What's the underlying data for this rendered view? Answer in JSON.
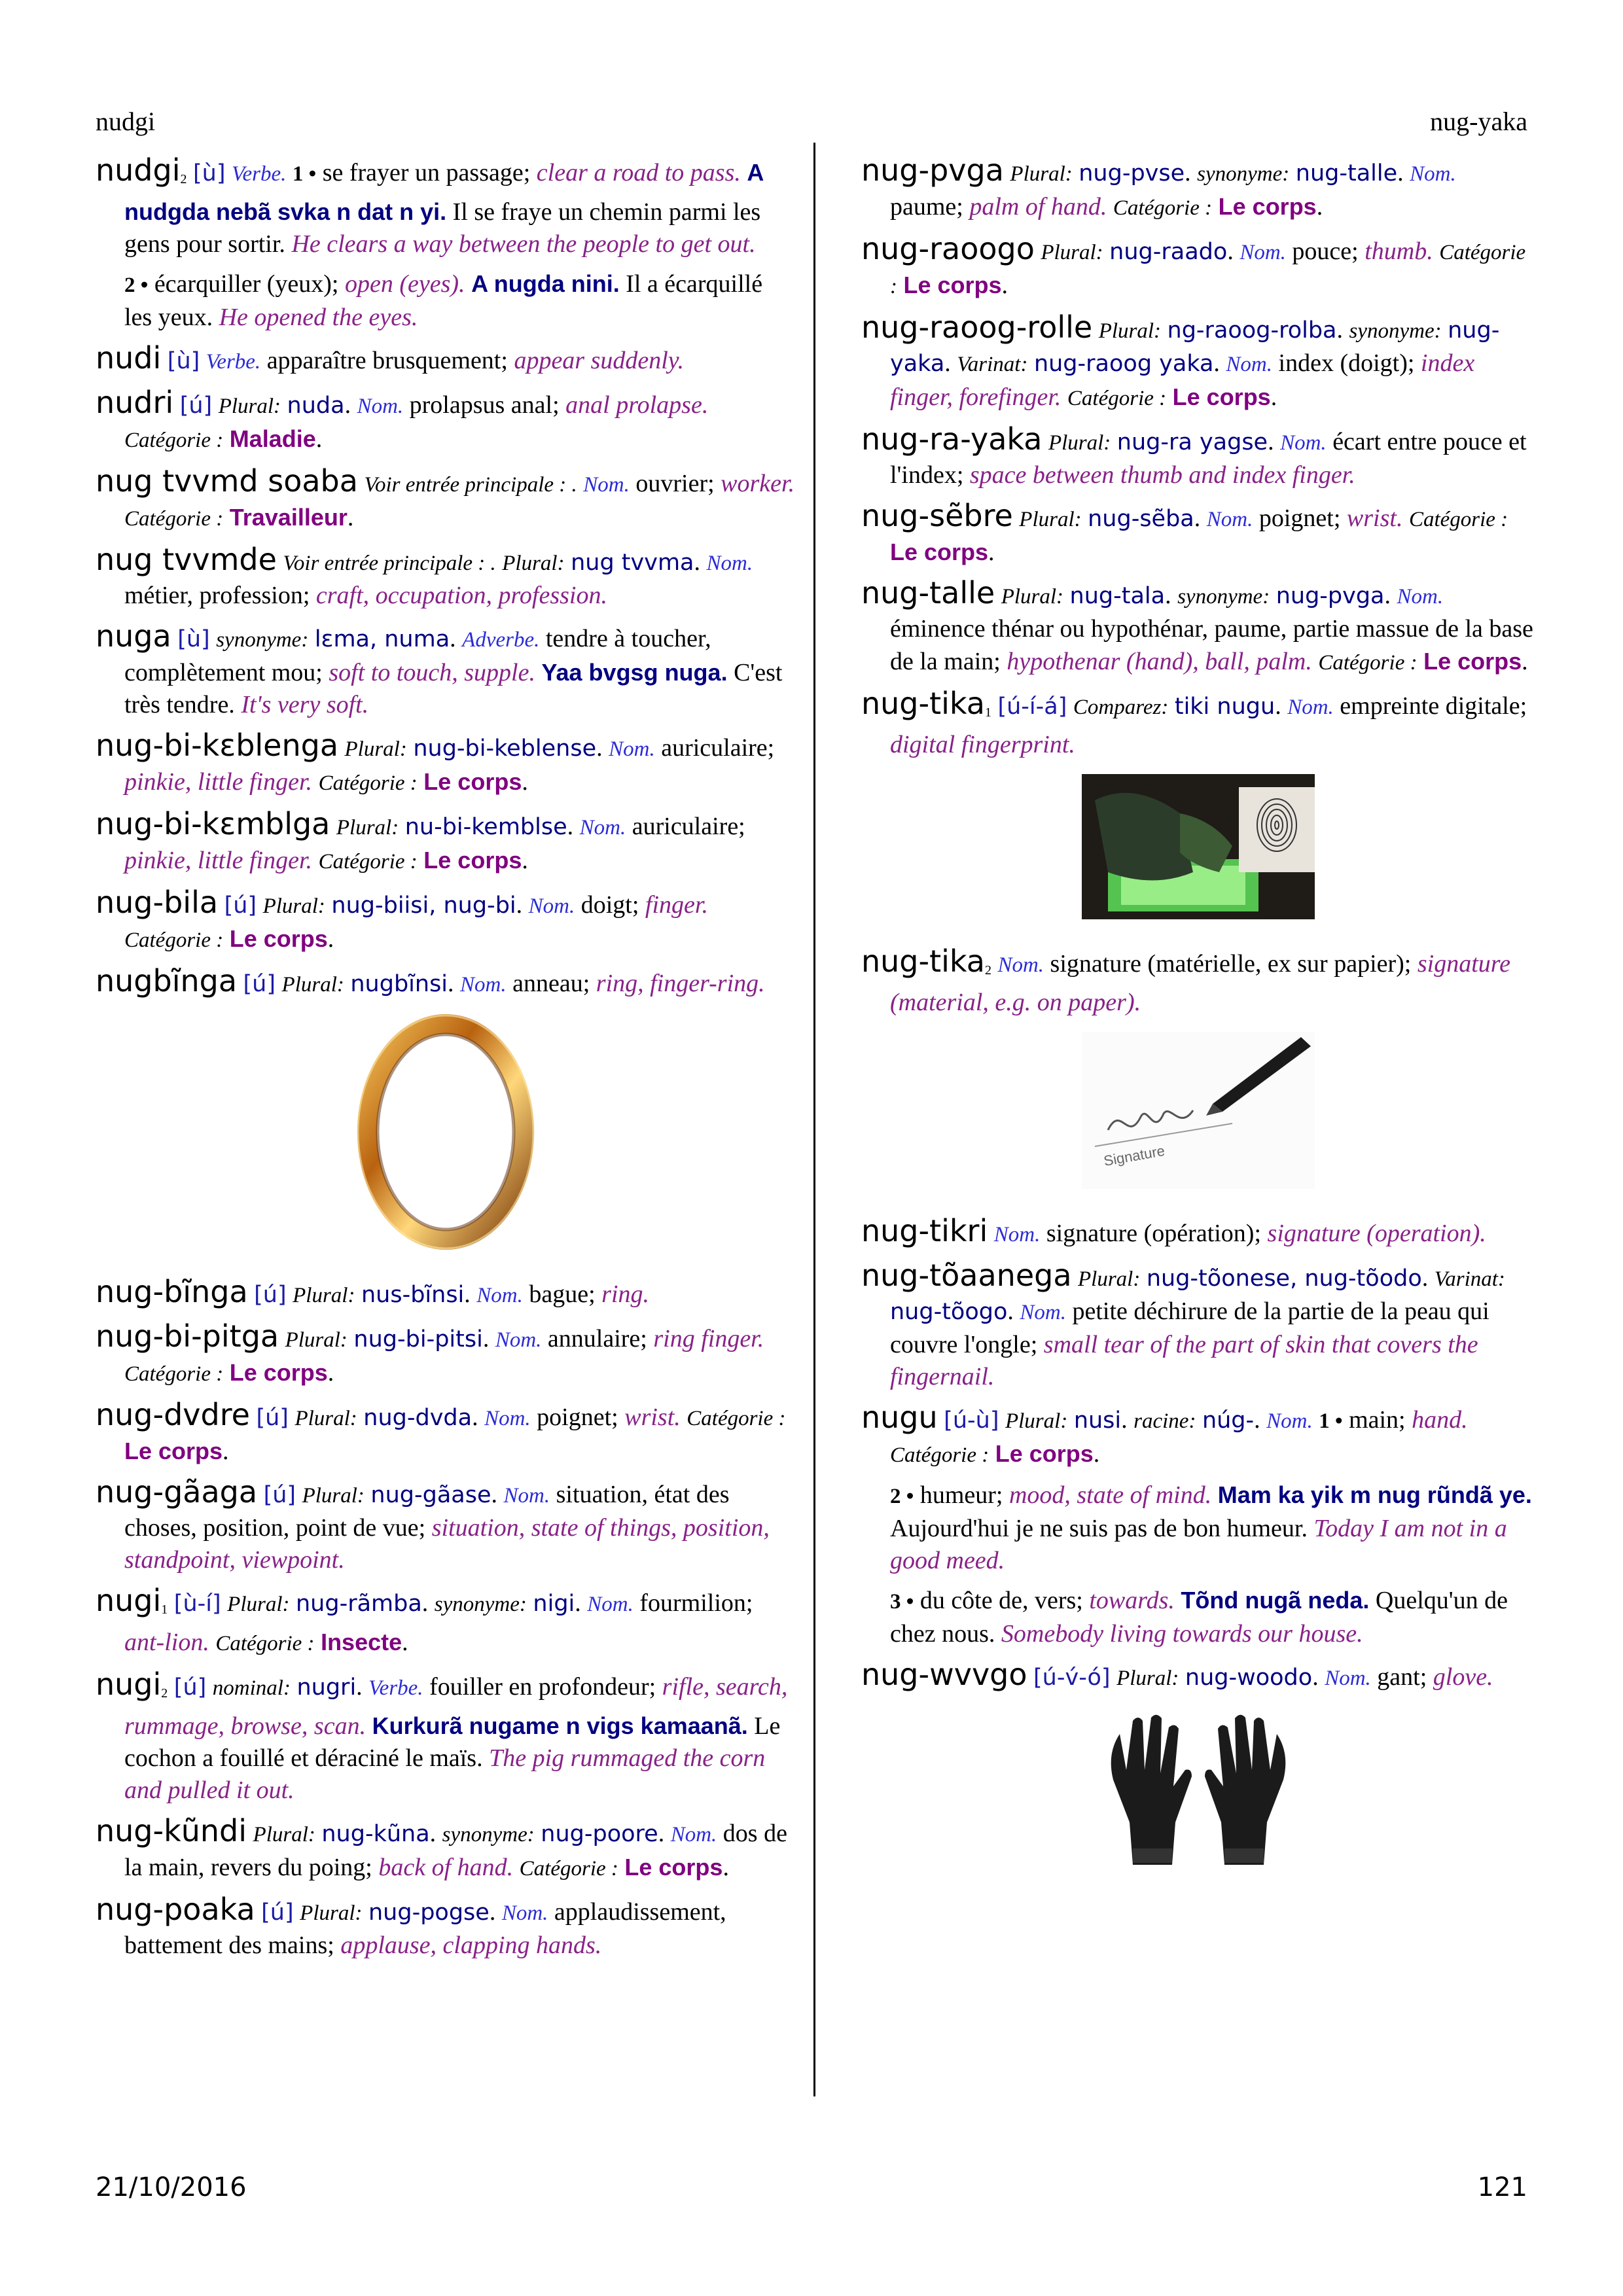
{
  "header": {
    "left": "nudgi",
    "right": "nug-yaka"
  },
  "footer": {
    "date": "21/10/2016",
    "page": "121"
  },
  "labels": {
    "plural": "Plural:",
    "synonyme": "synonyme:",
    "varinat": "Varinat:",
    "comparez": "Comparez:",
    "nominal": "nominal:",
    "racine": "racine:",
    "voir": "Voir entrée principale : .",
    "categorie": "Catégorie :",
    "nom": "Nom.",
    "verbe": "Verbe.",
    "adverbe": "Adverbe.",
    "le_corps": "Le corps",
    "maladie": "Maladie",
    "travailleur": "Travailleur",
    "insecte": "Insecte"
  },
  "entries": {
    "nudgi2": {
      "hw": "nudgi",
      "hom": "2",
      "ph": "[ù]",
      "s1_num": "1 •",
      "s1_fr": "se frayer un passage;",
      "s1_en": "clear a road to pass.",
      "s1_ex": "A nudgda nebã sᴠka n dat n yi.",
      "s1_ex_fr": "Il se fraye un chemin parmi les gens pour sortir.",
      "s1_ex_en": "He clears a way between the people to get out.",
      "s2_num": "2 •",
      "s2_fr": "écarquiller (yeux);",
      "s2_en": "open (eyes).",
      "s2_ex": "A nugda nini.",
      "s2_ex_fr": "Il a écarquillé les yeux.",
      "s2_ex_en": "He opened the eyes."
    },
    "nudi": {
      "hw": "nudi",
      "ph": "[ù]",
      "fr": "apparaître brusquement;",
      "en": "appear suddenly."
    },
    "nudri": {
      "hw": "nudri",
      "ph": "[ú]",
      "pl": "nuda",
      "fr": "prolapsus anal;",
      "en": "anal prolapse."
    },
    "soaba": {
      "hw": "nug tᴠᴠmd soaba",
      "fr": "ouvrier;",
      "en": "worker."
    },
    "tvvmde": {
      "hw": "nug tᴠᴠmde",
      "pl": "nug tᴠᴠma",
      "fr": "métier, profession;",
      "en": "craft, occupation, profession."
    },
    "nuga": {
      "hw": "nuga",
      "ph": "[ù]",
      "syn": "lɛma, numa",
      "fr": "tendre à toucher, complètement mou;",
      "en": "soft to touch, supple.",
      "ex": "Yaa bᴠgsg nuga.",
      "ex_fr": "C'est très tendre.",
      "ex_en": "It's very soft."
    },
    "kebl": {
      "hw": "nug-bi-kɛblenga",
      "pl": "nug-bi-keblense",
      "fr": "auriculaire;",
      "en": "pinkie, little finger."
    },
    "kembl": {
      "hw": "nug-bi-kɛmblga",
      "pl": "nu-bi-kemblse",
      "fr": "auriculaire;",
      "en": "pinkie, little finger."
    },
    "bila": {
      "hw": "nug-bila",
      "ph": "[ú]",
      "pl": "nug-biisi, nug-bi",
      "fr": "doigt;",
      "en": "finger."
    },
    "nugbinga": {
      "hw": "nugbĩnga",
      "ph": "[ú]",
      "pl": "nugbĩnsi",
      "fr": "anneau;",
      "en": "ring, finger-ring."
    },
    "binga": {
      "hw": "nug-bĩnga",
      "ph": "[ú]",
      "pl": "nus-bĩnsi",
      "fr": "bague;",
      "en": "ring."
    },
    "pitga": {
      "hw": "nug-bi-pitga",
      "pl": "nug-bi-pitsi",
      "fr": "annulaire;",
      "en": "ring finger."
    },
    "dvdre": {
      "hw": "nug-dᴠdre",
      "ph": "[ú]",
      "pl": "nug-dᴠda",
      "fr": "poignet;",
      "en": "wrist."
    },
    "gaaga": {
      "hw": "nug-gãaga",
      "ph": "[ú]",
      "pl": "nug-gãase",
      "fr": "situation, état des choses, position, point de vue;",
      "en": "situation, state of things, position, standpoint, viewpoint."
    },
    "nugi1": {
      "hw": "nugi",
      "hom": "1",
      "ph": "[ù-í]",
      "pl": "nug-rãmba",
      "syn": "nigi",
      "fr": "fourmilion;",
      "en": "ant-lion."
    },
    "nugi2": {
      "hw": "nugi",
      "hom": "2",
      "ph": "[ú]",
      "nominal": "nugri",
      "fr": "fouiller en profondeur;",
      "en": "rifle, search, rummage, browse, scan.",
      "ex": "Kurkurã nugame n vigs kamaanã.",
      "ex_fr": "Le cochon a fouillé et déraciné le maïs.",
      "ex_en": "The pig rummaged the corn and pulled it out."
    },
    "kundi": {
      "hw": "nug-kũndi",
      "pl": "nug-kũna",
      "syn": "nug-poore",
      "fr": "dos de la main, revers du poing;",
      "en": "back of hand."
    },
    "poaka": {
      "hw": "nug-poaka",
      "ph": "[ú]",
      "pl": "nug-pogse",
      "fr": "applaudissement, battement des mains;",
      "en": "applause, clapping hands."
    },
    "pvga": {
      "hw": "nug-pᴠga",
      "pl": "nug-pᴠse",
      "syn": "nug-talle",
      "fr": "paume;",
      "en": "palm of hand."
    },
    "raoogo": {
      "hw": "nug-raoogo",
      "pl": "nug-raado",
      "fr": "pouce;",
      "en": "thumb."
    },
    "rolle": {
      "hw": "nug-raoog-rolle",
      "pl": "ng-raoog-rolba",
      "syn": "nug-yaka",
      "var": "nug-raoog yaka",
      "fr": "index (doigt);",
      "en": "index finger, forefinger."
    },
    "rayaka": {
      "hw": "nug-ra-yaka",
      "pl": "nug-ra yagse",
      "fr": "écart entre pouce et l'index;",
      "en": "space between thumb and index finger."
    },
    "sebre": {
      "hw": "nug-sẽbre",
      "pl": "nug-sẽba",
      "fr": "poignet;",
      "en": "wrist."
    },
    "talle": {
      "hw": "nug-talle",
      "pl": "nug-tala",
      "syn": "nug-pᴠga",
      "fr": "éminence thénar ou hypothénar, paume, partie massue de la base de la main;",
      "en": "hypothenar (hand), ball, palm."
    },
    "tika1": {
      "hw": "nug-tika",
      "hom": "1",
      "ph": "[ú-í-á]",
      "cmp": "tiki nugu",
      "fr": "empreinte digitale;",
      "en": "digital fingerprint."
    },
    "tika2": {
      "hw": "nug-tika",
      "hom": "2",
      "fr": "signature (matérielle, ex sur papier);",
      "en": "signature (material, e.g. on paper)."
    },
    "tikri": {
      "hw": "nug-tikri",
      "fr": "signature (opération);",
      "en": "signature (operation)."
    },
    "toaanega": {
      "hw": "nug-tõaanega",
      "pl": "nug-tõonese, nug-tõodo",
      "var": "nug-tõogo",
      "fr": "petite déchirure de la partie de la peau qui couvre l'ongle;",
      "en": "small tear of the part of skin that covers the fingernail."
    },
    "nugu": {
      "hw": "nugu",
      "ph": "[ú-ù]",
      "pl": "nusi",
      "racine": "núg-",
      "s1_num": "1 •",
      "s1_fr": "main;",
      "s1_en": "hand.",
      "s2_num": "2 •",
      "s2_fr": "humeur;",
      "s2_en": "mood, state of mind.",
      "s2_ex": "Mam ka yik m nug rũndã ye.",
      "s2_ex_fr": "Aujourd'hui je ne suis pas de bon humeur.",
      "s2_ex_en": "Today I am not in a good meed.",
      "s3_num": "3 •",
      "s3_fr": "du côte de, vers;",
      "s3_en": "towards.",
      "s3_ex": "Tõnd nugã neda.",
      "s3_ex_fr": "Quelqu'un de chez nous.",
      "s3_ex_en": "Somebody living towards our house."
    },
    "wvvgo": {
      "hw": "nug-wᴠᴠgo",
      "ph": "[ú-ᴠ́-ó]",
      "pl": "nug-woodo",
      "fr": "gant;",
      "en": "glove."
    }
  },
  "images": {
    "ring": "ring-photo",
    "fingerprint": "fingerprint-photo",
    "signature": "signature-photo",
    "signature_word": "Signature",
    "gloves": "gloves-photo"
  }
}
